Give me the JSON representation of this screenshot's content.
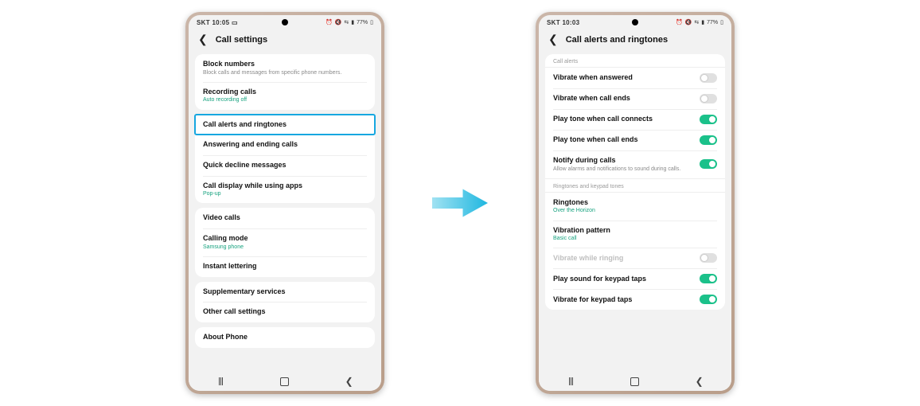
{
  "status": {
    "carrier": "SKT",
    "time1": "10:05",
    "time2": "10:03",
    "cam": "▭",
    "alarm": "⏰",
    "mute": "🔇",
    "wifi": "⇆",
    "signal": "▮",
    "battery": "77%",
    "bat_icon": "▯"
  },
  "left": {
    "title": "Call settings",
    "group1": [
      {
        "title": "Block numbers",
        "sub": "Block calls and messages from specific phone numbers."
      },
      {
        "title": "Recording calls",
        "sub": "Auto recording off",
        "green": true
      }
    ],
    "group2": [
      {
        "title": "Call alerts and ringtones",
        "highlight": true
      },
      {
        "title": "Answering and ending calls"
      },
      {
        "title": "Quick decline messages"
      },
      {
        "title": "Call display while using apps",
        "sub": "Pop-up",
        "green": true
      }
    ],
    "group3": [
      {
        "title": "Video calls"
      },
      {
        "title": "Calling mode",
        "sub": "Samsung phone",
        "green": true
      },
      {
        "title": "Instant lettering"
      }
    ],
    "group4": [
      {
        "title": "Supplementary services"
      },
      {
        "title": "Other call settings"
      }
    ],
    "group5": [
      {
        "title": "About Phone"
      }
    ]
  },
  "right": {
    "title": "Call alerts and ringtones",
    "section1_label": "Call alerts",
    "section1": [
      {
        "title": "Vibrate when answered",
        "on": false
      },
      {
        "title": "Vibrate when call ends",
        "on": false
      },
      {
        "title": "Play tone when call connects",
        "on": true
      },
      {
        "title": "Play tone when call ends",
        "on": true
      },
      {
        "title": "Notify during calls",
        "sub": "Allow alarms and notifications to sound during calls.",
        "on": true
      }
    ],
    "section2_label": "Ringtones and keypad tones",
    "ringtones": {
      "title": "Ringtones",
      "sub": "Over the Horizon"
    },
    "vibpattern": {
      "title": "Vibration pattern",
      "sub": "Basic call"
    },
    "section2_toggles": [
      {
        "title": "Vibrate while ringing",
        "on": false,
        "disabled": true
      },
      {
        "title": "Play sound for keypad taps",
        "on": true
      },
      {
        "title": "Vibrate for keypad taps",
        "on": true
      }
    ]
  }
}
